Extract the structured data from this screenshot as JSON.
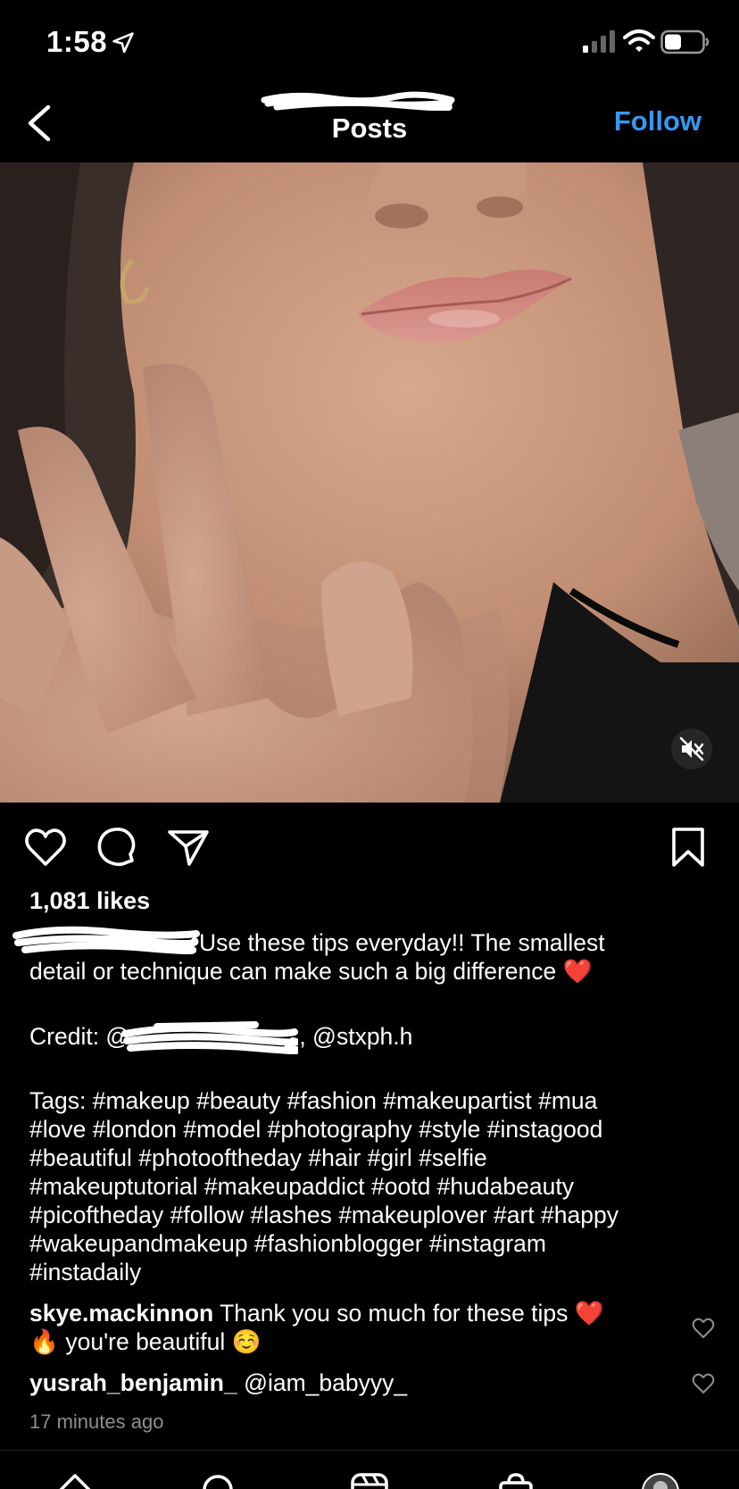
{
  "status_bar": {
    "time": "1:58"
  },
  "header": {
    "title": "Posts",
    "follow_label": "Follow"
  },
  "post": {
    "likes": "1,081 likes",
    "caption_line1": "Use these tips everyday!! The smallest",
    "caption_line2": "detail or technique can make such a big difference ❤️",
    "credit_prefix": "Credit: @",
    "credit_suffix": ", @stxph.h",
    "tags": [
      "Tags: #makeup #beauty #fashion #makeupartist #mua",
      "#love #london #model #photography #style #instagood",
      "#beautiful #photooftheday #hair #girl #selfie",
      "#makeuptutorial #makeupaddict #ootd #hudabeauty",
      "#picoftheday #follow #lashes #makeuplover #art #happy",
      "#wakeupandmakeup #fashionblogger #instagram",
      "#instadaily"
    ]
  },
  "comments": [
    {
      "username": "skye.mackinnon",
      "text_line1": " Thank you so much for these tips ❤️",
      "text_line2": "🔥 you're beautiful ☺️"
    },
    {
      "username": "yusrah_benjamin_",
      "text_line1": " @iam_babyyy_"
    }
  ],
  "timestamp": "17 minutes ago",
  "icons": {
    "accent_color": "#3897f0",
    "like": "heart-icon",
    "comment": "comment-bubble-icon",
    "share": "paper-plane-icon",
    "save": "bookmark-icon",
    "mute": "speaker-muted-icon"
  }
}
